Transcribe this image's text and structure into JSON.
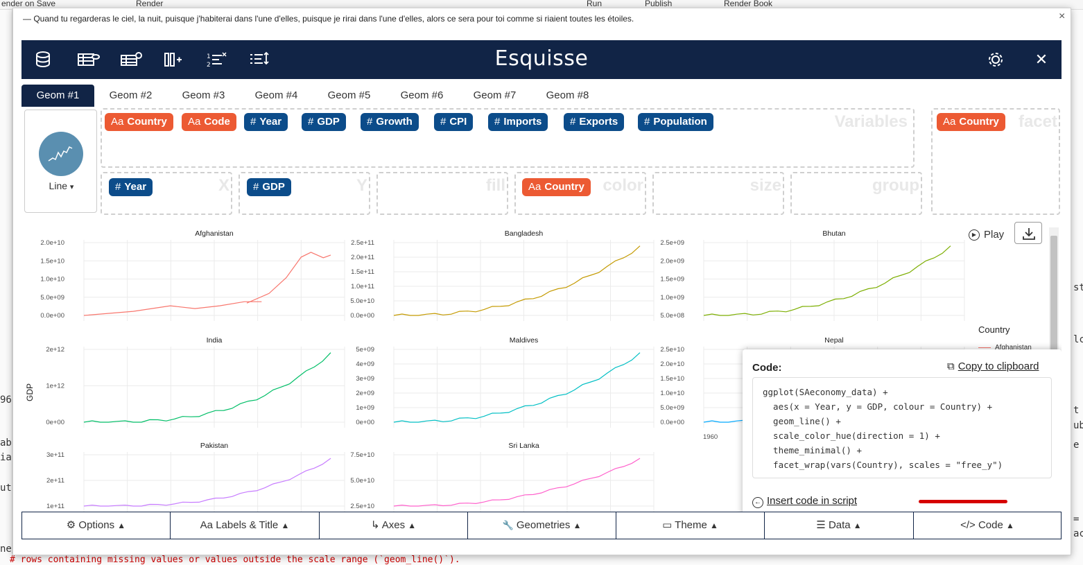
{
  "background": {
    "toolbar_items": [
      "ender on Save",
      "Render",
      "Run",
      "Publish",
      "Render Book"
    ],
    "left_lines": [
      "ab",
      "ia",
      "ut",
      "96",
      "ne/"
    ],
    "right_lines": [
      "st",
      "lc",
      "t",
      "ub",
      "e",
      "ac",
      "="
    ],
    "bottom_text": "# rows containing missing values or values outside the scale range (`geom_line()`)."
  },
  "dialog": {
    "quote": "— Quand tu regarderas le ciel, la nuit, puisque j'habiterai dans l'une d'elles, puisque je rirai dans l'une d'elles, alors ce sera pour toi comme si riaient toutes les étoiles.",
    "close_label": "×"
  },
  "app": {
    "title": "Esquisse",
    "close_label": "✕"
  },
  "geom_tabs": [
    "Geom #1",
    "Geom #2",
    "Geom #3",
    "Geom #4",
    "Geom #5",
    "Geom #6",
    "Geom #7",
    "Geom #8"
  ],
  "geom_select": {
    "label": "Line",
    "caret": "▾"
  },
  "variables": {
    "title": "Variables",
    "chips": [
      {
        "type": "cat",
        "prefix": "Aa",
        "label": "Country"
      },
      {
        "type": "cat",
        "prefix": "Aa",
        "label": "Code"
      },
      {
        "type": "num",
        "prefix": "#",
        "label": "Year"
      },
      {
        "type": "num",
        "prefix": "#",
        "label": "GDP"
      },
      {
        "type": "num",
        "prefix": "#",
        "label": "Growth"
      },
      {
        "type": "num",
        "prefix": "#",
        "label": "CPI"
      },
      {
        "type": "num",
        "prefix": "#",
        "label": "Imports"
      },
      {
        "type": "num",
        "prefix": "#",
        "label": "Exports"
      },
      {
        "type": "num",
        "prefix": "#",
        "label": "Population"
      }
    ]
  },
  "facet": {
    "title": "facet",
    "chip": {
      "prefix": "Aa",
      "label": "Country"
    }
  },
  "zones": {
    "x": {
      "title": "X",
      "chip": {
        "prefix": "#",
        "label": "Year"
      }
    },
    "y": {
      "title": "Y",
      "chip": {
        "prefix": "#",
        "label": "GDP"
      }
    },
    "fill": {
      "title": "fill"
    },
    "color": {
      "title": "color",
      "chip": {
        "prefix": "Aa",
        "label": "Country"
      }
    },
    "size": {
      "title": "size"
    },
    "group": {
      "title": "group"
    }
  },
  "plot": {
    "play_label": "Play",
    "y_axis_title": "GDP",
    "legend_title": "Country",
    "legend_first": "Afghanistan",
    "x_tick_visible": "1960",
    "panels": [
      {
        "name": "Afghanistan",
        "color": "#F8766D",
        "ticks": [
          "2.0e+10",
          "1.5e+10",
          "1.0e+10",
          "5.0e+09",
          "0.0e+00"
        ]
      },
      {
        "name": "Bangladesh",
        "color": "#C49A00",
        "ticks": [
          "2.5e+11",
          "2.0e+11",
          "1.5e+11",
          "1.0e+11",
          "5.0e+10",
          "0.0e+00"
        ]
      },
      {
        "name": "Bhutan",
        "color": "#7CAE00",
        "ticks": [
          "2.5e+09",
          "2.0e+09",
          "1.5e+09",
          "1.0e+09",
          "5.0e+08"
        ]
      },
      {
        "name": "India",
        "color": "#00BE67",
        "ticks": [
          "2e+12",
          "1e+12",
          "0e+00"
        ]
      },
      {
        "name": "Maldives",
        "color": "#00BFC4",
        "ticks": [
          "5e+09",
          "4e+09",
          "3e+09",
          "2e+09",
          "1e+09",
          "0e+00"
        ]
      },
      {
        "name": "Nepal",
        "color": "#00A9FF",
        "ticks": [
          "2.5e+10",
          "2.0e+10",
          "1.5e+10",
          "1.0e+10",
          "5.0e+09",
          "0.0e+00"
        ]
      },
      {
        "name": "Pakistan",
        "color": "#C77CFF",
        "ticks": [
          "3e+11",
          "2e+11",
          "1e+11"
        ]
      },
      {
        "name": "Sri Lanka",
        "color": "#FF61CC",
        "ticks": [
          "7.5e+10",
          "5.0e+10",
          "2.5e+10"
        ]
      }
    ]
  },
  "code_panel": {
    "label": "Code:",
    "copy_label": "Copy to clipboard",
    "insert_label": "Insert code in script",
    "lines": [
      "ggplot(SAeconomy_data) +",
      "  aes(x = Year, y = GDP, colour = Country) +",
      "  geom_line() +",
      "  scale_color_hue(direction = 1) +",
      "  theme_minimal() +",
      "  facet_wrap(vars(Country), scales = \"free_y\")"
    ]
  },
  "bottom_buttons": [
    {
      "icon": "⚙",
      "label": "Options"
    },
    {
      "icon": "Aa",
      "label": "Labels & Title"
    },
    {
      "icon": "↳",
      "label": "Axes"
    },
    {
      "icon": "🔧",
      "label": "Geometries"
    },
    {
      "icon": "▭",
      "label": "Theme"
    },
    {
      "icon": "☰",
      "label": "Data"
    },
    {
      "icon": "</>",
      "label": "Code"
    }
  ],
  "caret_up": "▲"
}
